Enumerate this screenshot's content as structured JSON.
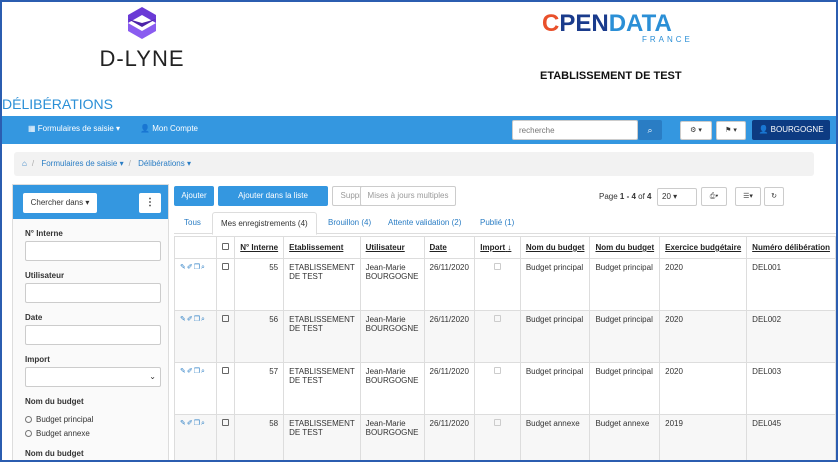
{
  "brand": {
    "name": "D-LYNE"
  },
  "partner": {
    "logo_o": "C",
    "logo_pen": "PEN",
    "logo_data": "DATA",
    "logo_sub": "FRANCE"
  },
  "etablissement": "ETABLISSEMENT DE TEST",
  "page_title": "DÉLIBÉRATIONS",
  "navbar": {
    "formulaires": "Formulaires de saisie",
    "compte": "Mon Compte",
    "search_placeholder": "recherche",
    "user": "BOURGOGNE"
  },
  "breadcrumb": {
    "item1": "Formulaires de saisie",
    "item2": "Délibérations"
  },
  "sidebar": {
    "chercher": "Chercher dans",
    "f_interne": "N° Interne",
    "f_utilisateur": "Utilisateur",
    "f_date": "Date",
    "f_import": "Import",
    "f_budget": "Nom du budget",
    "opt1": "Budget principal",
    "opt2": "Budget annexe",
    "f_budget2": "Nom du budget"
  },
  "toolbar": {
    "ajouter": "Ajouter",
    "ajouter_liste": "Ajouter dans la liste",
    "supprimer": "Supprimer",
    "maj": "Mises à jours multiples",
    "page_prefix": "Page ",
    "page_range": "1 - 4",
    "page_of": " of ",
    "page_total": "4",
    "page_size": "20"
  },
  "tabs": [
    "Tous",
    "Mes enregistrements (4)",
    "Brouillon (4)",
    "Attente validation (2)",
    "Publié (1)"
  ],
  "table": {
    "headers": [
      "N° Interne",
      "Etablissement",
      "Utilisateur",
      "Date",
      "Import",
      "Nom du budget",
      "Nom du budget",
      "Exercice budgétaire",
      "Numéro délibération"
    ],
    "rows": [
      {
        "num": "55",
        "etab": "ETABLISSEMENT DE TEST",
        "user": "Jean-Marie BOURGOGNE",
        "date": "26/11/2020",
        "budget1": "Budget principal",
        "budget2": "Budget principal",
        "exercice": "2020",
        "delib": "DEL001"
      },
      {
        "num": "56",
        "etab": "ETABLISSEMENT DE TEST",
        "user": "Jean-Marie BOURGOGNE",
        "date": "26/11/2020",
        "budget1": "Budget principal",
        "budget2": "Budget principal",
        "exercice": "2020",
        "delib": "DEL002"
      },
      {
        "num": "57",
        "etab": "ETABLISSEMENT DE TEST",
        "user": "Jean-Marie BOURGOGNE",
        "date": "26/11/2020",
        "budget1": "Budget principal",
        "budget2": "Budget principal",
        "exercice": "2020",
        "delib": "DEL003"
      },
      {
        "num": "58",
        "etab": "ETABLISSEMENT DE TEST",
        "user": "Jean-Marie BOURGOGNE",
        "date": "26/11/2020",
        "budget1": "Budget annexe",
        "budget2": "Budget annexe",
        "exercice": "2019",
        "delib": "DEL045"
      }
    ]
  },
  "colors": {
    "accent": "#3497e0",
    "dark": "#0d3b82",
    "frame": "#2b5db0"
  }
}
